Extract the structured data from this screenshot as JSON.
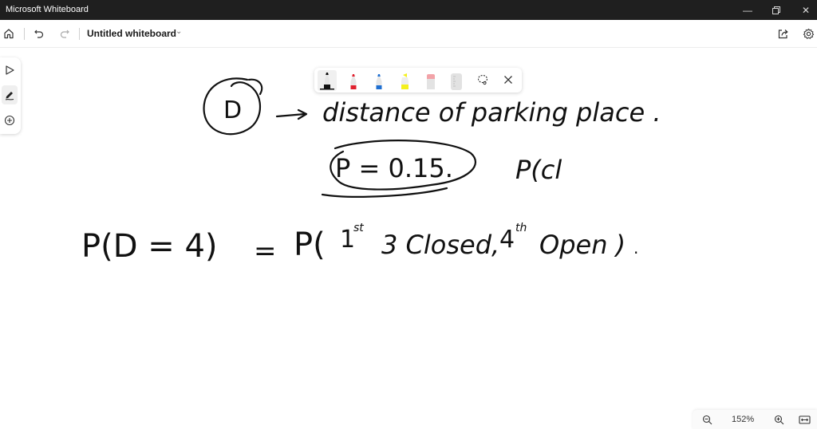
{
  "window": {
    "app_title": "Microsoft Whiteboard",
    "controls": [
      "minimize",
      "restore",
      "close"
    ]
  },
  "appbar": {
    "home_icon": "home-icon",
    "undo_icon": "undo-icon",
    "redo_icon": "redo-icon",
    "doc_title": "Untitled whiteboard",
    "share_icon": "share-icon",
    "settings_icon": "gear-icon"
  },
  "side_toolbar": {
    "items": [
      {
        "name": "select-tool",
        "icon": "pointer-icon",
        "active": false
      },
      {
        "name": "ink-tool",
        "icon": "pen-icon",
        "active": true
      },
      {
        "name": "add-tool",
        "icon": "plus-circle-icon",
        "active": false
      }
    ]
  },
  "pen_tray": {
    "pens": [
      {
        "name": "black-pen",
        "color": "#111111",
        "selected": true
      },
      {
        "name": "red-pen",
        "color": "#e0202e",
        "selected": false
      },
      {
        "name": "blue-pen",
        "color": "#1f6fd1",
        "selected": false
      },
      {
        "name": "yellow-highlighter",
        "color": "#f4f01c",
        "selected": false
      },
      {
        "name": "eraser",
        "color": "#f2a3a8",
        "selected": false
      },
      {
        "name": "ruler",
        "color": "#d6d6d6",
        "selected": false
      }
    ],
    "lasso_icon": "lasso-select-icon",
    "close_icon": "close-icon"
  },
  "canvas": {
    "ink": {
      "line1_symbol": "D",
      "line1_arrow": "→",
      "line1_text": "distance of parking place .",
      "line2_boxed": "P = 0.15.",
      "line2_extra": "P(cl",
      "line3_lhs": "P(D = 4)",
      "line3_eq": "=",
      "line3_rhs_p": "P(",
      "line3_first": "1",
      "line3_sup_st": "st",
      "line3_closed": "3 Closed,",
      "line3_fourth": "4",
      "line3_sup_th": "th",
      "line3_open": "Open )",
      "line3_dot": "."
    }
  },
  "zoom": {
    "zoom_out_icon": "zoom-out-icon",
    "level": "152%",
    "zoom_in_icon": "zoom-in-icon",
    "fit_icon": "fit-to-screen-icon"
  }
}
